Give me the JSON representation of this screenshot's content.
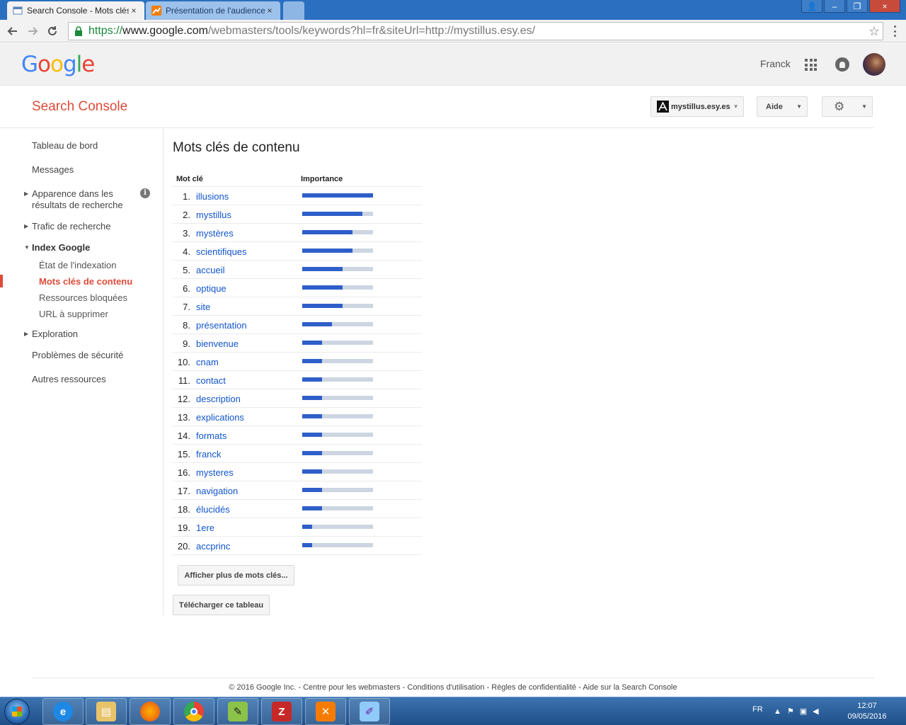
{
  "browser": {
    "tabs": [
      {
        "title": "Search Console - Mots clés",
        "close": "×"
      },
      {
        "title": "Présentation de l'audience",
        "close": "×"
      }
    ],
    "url": {
      "scheme": "https://",
      "host": "www.google.com",
      "path": "/webmasters/tools/keywords?hl=fr&siteUrl=http://mystillus.esy.es/"
    },
    "window_buttons": {
      "user": "👤",
      "minimize": "–",
      "restore": "❐",
      "close": "×"
    }
  },
  "google_header": {
    "logo": [
      "G",
      "o",
      "o",
      "g",
      "l",
      "e"
    ],
    "username": "Franck"
  },
  "console_bar": {
    "title": "Search Console",
    "site": "mystillus.esy.es",
    "help": "Aide"
  },
  "sidebar": {
    "dashboard": "Tableau de bord",
    "messages": "Messages",
    "appearance": "Apparence dans les résultats de recherche",
    "traffic": "Trafic de recherche",
    "index": "Index Google",
    "index_status": "État de l'indexation",
    "content_keywords": "Mots clés de contenu",
    "blocked_resources": "Ressources bloquées",
    "remove_urls": "URL à supprimer",
    "crawl": "Exploration",
    "security": "Problèmes de sécurité",
    "other": "Autres ressources",
    "info": "i"
  },
  "main": {
    "title": "Mots clés de contenu",
    "col_keyword": "Mot clé",
    "col_importance": "Importance",
    "keywords": [
      {
        "rank": "1.",
        "word": "illusions",
        "importance": 1.0
      },
      {
        "rank": "2.",
        "word": "mystillus",
        "importance": 0.85
      },
      {
        "rank": "3.",
        "word": "mystères",
        "importance": 0.71
      },
      {
        "rank": "4.",
        "word": "scientifiques",
        "importance": 0.71
      },
      {
        "rank": "5.",
        "word": "accueil",
        "importance": 0.57
      },
      {
        "rank": "6.",
        "word": "optique",
        "importance": 0.57
      },
      {
        "rank": "7.",
        "word": "site",
        "importance": 0.57
      },
      {
        "rank": "8.",
        "word": "présentation",
        "importance": 0.42
      },
      {
        "rank": "9.",
        "word": "bienvenue",
        "importance": 0.28
      },
      {
        "rank": "10.",
        "word": "cnam",
        "importance": 0.28
      },
      {
        "rank": "11.",
        "word": "contact",
        "importance": 0.28
      },
      {
        "rank": "12.",
        "word": "description",
        "importance": 0.28
      },
      {
        "rank": "13.",
        "word": "explications",
        "importance": 0.28
      },
      {
        "rank": "14.",
        "word": "formats",
        "importance": 0.28
      },
      {
        "rank": "15.",
        "word": "franck",
        "importance": 0.28
      },
      {
        "rank": "16.",
        "word": "mysteres",
        "importance": 0.28
      },
      {
        "rank": "17.",
        "word": "navigation",
        "importance": 0.28
      },
      {
        "rank": "18.",
        "word": "élucidés",
        "importance": 0.28
      },
      {
        "rank": "19.",
        "word": "1ere",
        "importance": 0.14
      },
      {
        "rank": "20.",
        "word": "accprinc",
        "importance": 0.14
      }
    ],
    "more_button": "Afficher plus de mots clés...",
    "download_button": "Télécharger ce tableau",
    "colors": {
      "bar_fill": "#2e5ec9",
      "bar_track": "#cdd5e2",
      "link": "#1155cc",
      "accent": "#dd4b39"
    }
  },
  "footer": {
    "text": "© 2016 Google Inc. - Centre pour les webmasters - Conditions d'utilisation - Règles de confidentialité - Aide sur la Search Console"
  },
  "taskbar": {
    "apps": [
      "internet-explorer",
      "file-explorer",
      "firefox",
      "chrome",
      "notepad-plus-plus",
      "filezilla",
      "xampp",
      "paint"
    ],
    "language": "FR",
    "time": "12:07",
    "date": "09/05/2016"
  }
}
